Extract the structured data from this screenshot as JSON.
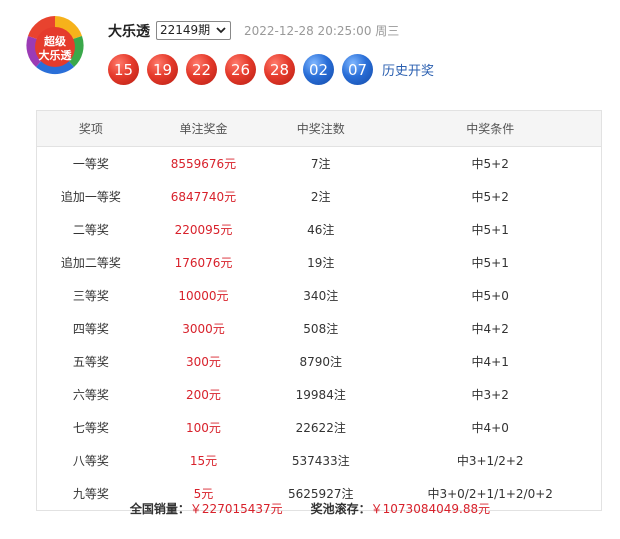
{
  "logo": {
    "line1": "超级",
    "line2": "大乐透"
  },
  "header": {
    "title": "大乐透",
    "issue": "22149期",
    "datetime": "2022-12-28 20:25:00 周三",
    "history_link": "历史开奖"
  },
  "balls": [
    {
      "num": "15",
      "color": "red"
    },
    {
      "num": "19",
      "color": "red"
    },
    {
      "num": "22",
      "color": "red"
    },
    {
      "num": "26",
      "color": "red"
    },
    {
      "num": "28",
      "color": "red"
    },
    {
      "num": "02",
      "color": "blue"
    },
    {
      "num": "07",
      "color": "blue"
    }
  ],
  "table": {
    "headers": [
      "奖项",
      "单注奖金",
      "中奖注数",
      "中奖条件"
    ],
    "rows": [
      [
        "一等奖",
        "8559676元",
        "7注",
        "中5+2"
      ],
      [
        "追加一等奖",
        "6847740元",
        "2注",
        "中5+2"
      ],
      [
        "二等奖",
        "220095元",
        "46注",
        "中5+1"
      ],
      [
        "追加二等奖",
        "176076元",
        "19注",
        "中5+1"
      ],
      [
        "三等奖",
        "10000元",
        "340注",
        "中5+0"
      ],
      [
        "四等奖",
        "3000元",
        "508注",
        "中4+2"
      ],
      [
        "五等奖",
        "300元",
        "8790注",
        "中4+1"
      ],
      [
        "六等奖",
        "200元",
        "19984注",
        "中3+2"
      ],
      [
        "七等奖",
        "100元",
        "22622注",
        "中4+0"
      ],
      [
        "八等奖",
        "15元",
        "537433注",
        "中3+1/2+2"
      ],
      [
        "九等奖",
        "5元",
        "5625927注",
        "中3+0/2+1/1+2/0+2"
      ]
    ]
  },
  "footer": {
    "sales_label": "全国销量：",
    "sales_value": "￥227015437元",
    "pool_label": "奖池滚存：",
    "pool_value": "￥1073084049.88元"
  }
}
